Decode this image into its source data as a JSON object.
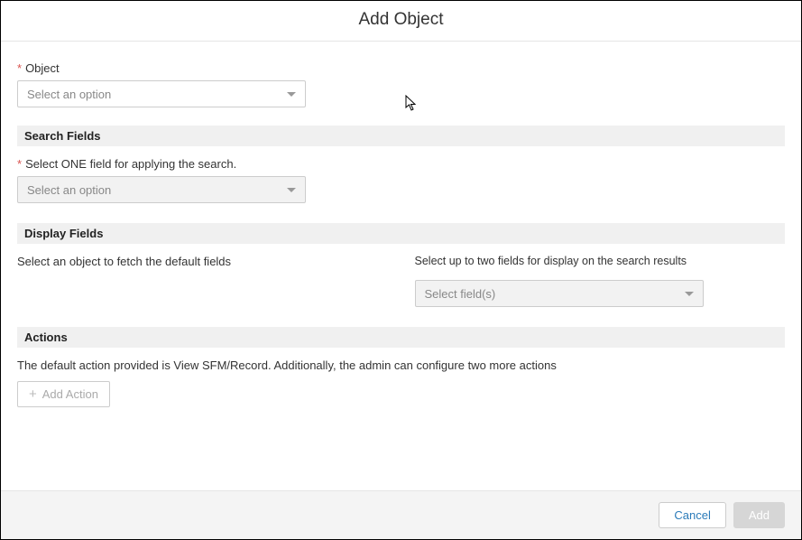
{
  "dialog": {
    "title": "Add Object"
  },
  "object_field": {
    "label": "Object",
    "placeholder": "Select an option"
  },
  "search_fields": {
    "header": "Search Fields",
    "label": "Select ONE field for applying the search.",
    "placeholder": "Select an option"
  },
  "display_fields": {
    "header": "Display Fields",
    "left_text": "Select an object to fetch the default fields",
    "right_hint": "Select up to two fields for display on the search results",
    "placeholder": "Select field(s)"
  },
  "actions": {
    "header": "Actions",
    "description": "The default action provided is View SFM/Record. Additionally, the admin can configure two more actions",
    "add_action_label": "Add Action"
  },
  "footer": {
    "cancel_label": "Cancel",
    "add_label": "Add"
  }
}
